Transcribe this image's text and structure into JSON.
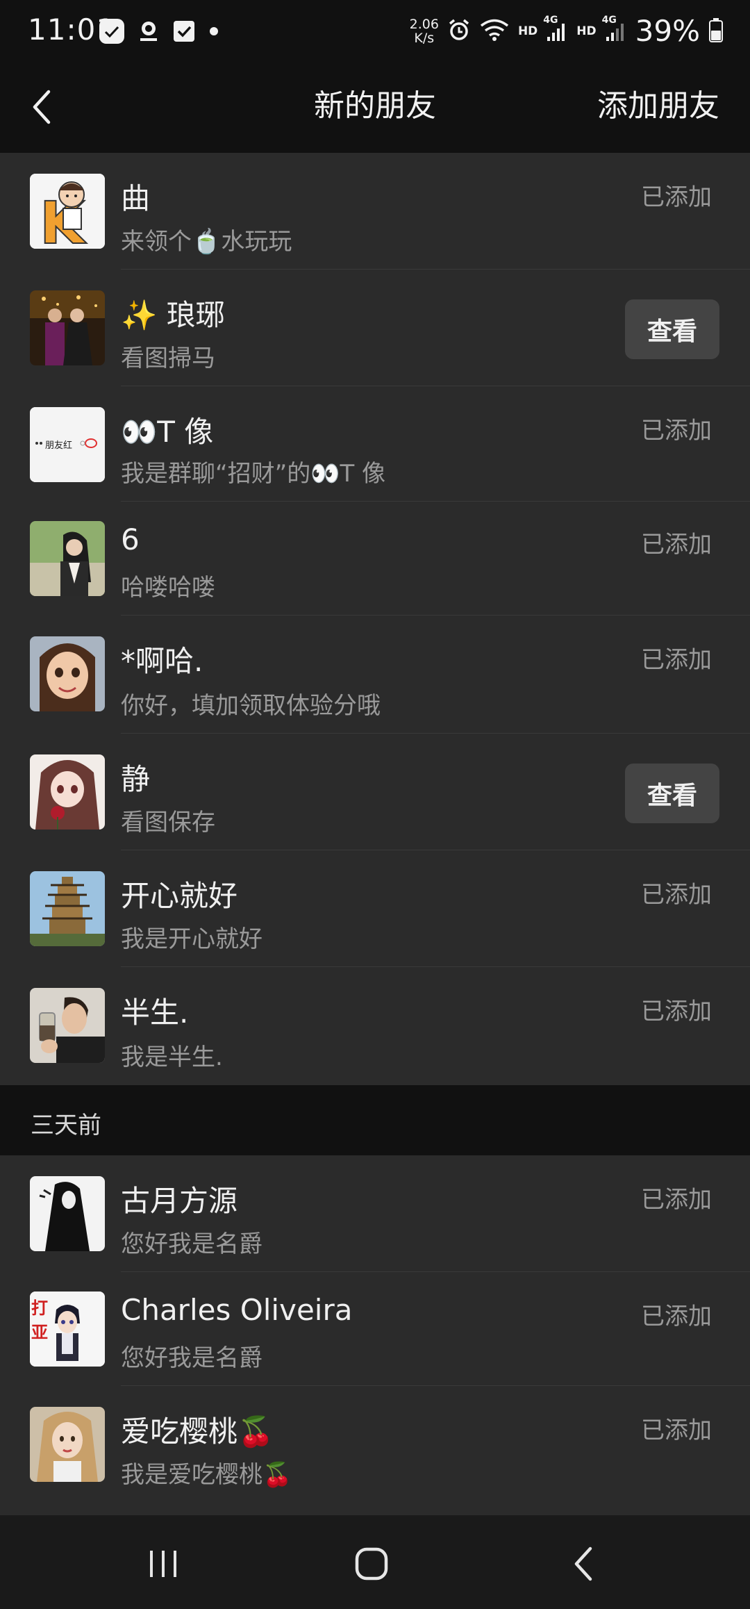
{
  "status_bar": {
    "time": "11:01",
    "net_speed_value": "2.06",
    "net_speed_unit": "K/s",
    "hd1": "HD",
    "sig1": "4G",
    "hd2": "HD",
    "sig2": "4G",
    "battery": "39%",
    "icons": [
      "chat-app-icon",
      "app-logo-icon",
      "checkbox-icon",
      "dot-icon",
      "alarm-icon",
      "wifi-icon",
      "signal-icon",
      "battery-icon"
    ]
  },
  "nav": {
    "title": "新的朋友",
    "action": "添加朋友",
    "back_icon": "chevron-left-icon"
  },
  "recent": [
    {
      "name": "曲",
      "message": "来领个🍵水玩玩",
      "status": "已添加",
      "action_type": "status",
      "avatar": "cartoon-k-avatar"
    },
    {
      "name": "✨ 琅琊",
      "message": "看图掃马",
      "status": "查看",
      "action_type": "button",
      "avatar": "couple-photo-avatar"
    },
    {
      "name": "👀T 像",
      "message": "我是群聊“招财”的👀T 像",
      "status": "已添加",
      "action_type": "status",
      "avatar": "text-card-avatar",
      "avatar_text": "朋友红"
    },
    {
      "name": "6",
      "message": "哈喽哈喽",
      "status": "已添加",
      "action_type": "status",
      "avatar": "woman-outdoor-avatar"
    },
    {
      "name": "*啊哈.",
      "message": "你好，填加领取体验分哦",
      "status": "已添加",
      "action_type": "status",
      "avatar": "3d-girl-avatar"
    },
    {
      "name": "静",
      "message": "看图保存",
      "status": "查看",
      "action_type": "button",
      "avatar": "anime-girl-rose-avatar"
    },
    {
      "name": "开心就好",
      "message": "我是开心就好",
      "status": "已添加",
      "action_type": "status",
      "avatar": "pagoda-avatar"
    },
    {
      "name": "半生.",
      "message": "我是半生.",
      "status": "已添加",
      "action_type": "status",
      "avatar": "man-drink-avatar"
    }
  ],
  "section_label": "三天前",
  "older": [
    {
      "name": "古月方源",
      "message": "您好我是名爵",
      "status": "已添加",
      "action_type": "status",
      "avatar": "ink-figure-avatar"
    },
    {
      "name": "Charles Oliveira",
      "message": "您好我是名爵",
      "status": "已添加",
      "action_type": "status",
      "avatar": "anime-boy-avatar",
      "avatar_text": "打亚"
    },
    {
      "name": "爱吃樱桃🍒",
      "message": "我是爱吃樱桃🍒",
      "status": "已添加",
      "action_type": "status",
      "avatar": "blonde-girl-avatar"
    }
  ],
  "system_nav": {
    "recents_icon": "recent-apps-icon",
    "home_icon": "home-icon",
    "back_icon": "system-back-icon"
  }
}
